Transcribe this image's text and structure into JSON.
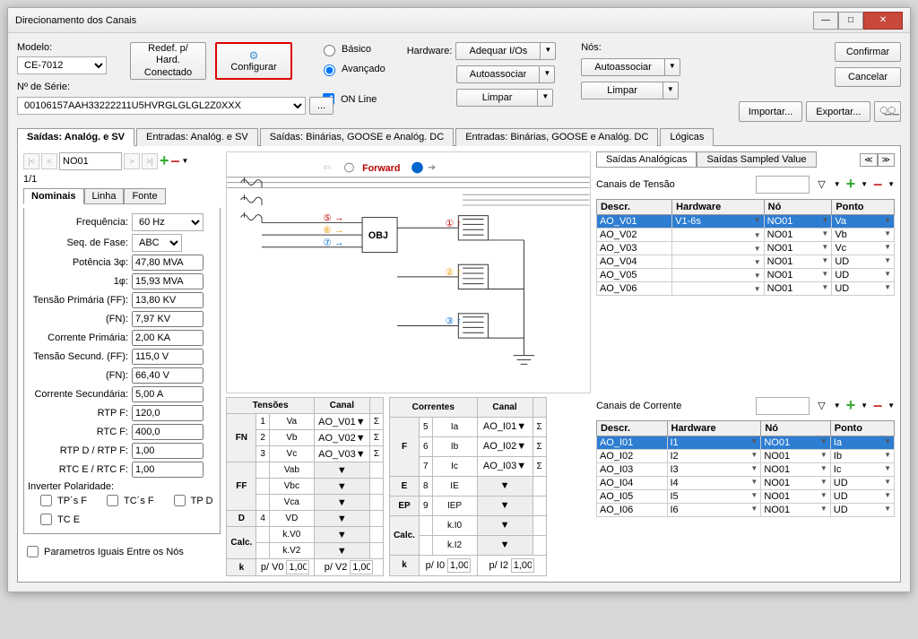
{
  "window": {
    "title": "Direcionamento dos Canais"
  },
  "top": {
    "model_lbl": "Modelo:",
    "model_val": "CE-7012",
    "serial_lbl": "Nº de Série:",
    "serial_val": "00106157AAH33222211U5HVRGLGLGL2Z0XXX",
    "redef": "Redef. p/ Hard.\nConectado",
    "configurar": "Configurar",
    "basico": "Básico",
    "avancado": "Avançado",
    "online": "ON Line",
    "hardware_lbl": "Hardware:",
    "adequar": "Adequar I/Os",
    "autoassociar": "Autoassociar",
    "limpar": "Limpar",
    "nos_lbl": "Nós:",
    "confirmar": "Confirmar",
    "cancelar": "Cancelar",
    "importar": "Importar...",
    "exportar": "Exportar..."
  },
  "tabs": {
    "t1": "Saídas: Analóg. e SV",
    "t2": "Entradas: Analóg. e SV",
    "t3": "Saídas: Binárias, GOOSE e Analóg. DC",
    "t4": "Entradas: Binárias, GOOSE e Analóg. DC",
    "t5": "Lógicas"
  },
  "left": {
    "node": "NO01",
    "count": "1/1",
    "sub1": "Nominais",
    "sub2": "Linha",
    "sub3": "Fonte",
    "freq_lbl": "Frequência:",
    "freq_val": "60 Hz",
    "seq_lbl": "Seq. de Fase:",
    "seq_val": "ABC",
    "pot3_lbl": "Potência 3φ:",
    "pot3_val": "47,80 MVA",
    "pot1_lbl": "1φ:",
    "pot1_val": "15,93 MVA",
    "tpff_lbl": "Tensão Primária (FF):",
    "tpff_val": "13,80 KV",
    "tpfn_lbl": "(FN):",
    "tpfn_val": "7,97 KV",
    "corrp_lbl": "Corrente Primária:",
    "corrp_val": "2,00 KA",
    "tsff_lbl": "Tensão Secund. (FF):",
    "tsff_val": "115,0 V",
    "tsfn_lbl": "(FN):",
    "tsfn_val": "66,40 V",
    "corrs_lbl": "Corrente Secundária:",
    "corrs_val": "5,00 A",
    "rtpf_lbl": "RTP F:",
    "rtpf_val": "120,0",
    "rtcf_lbl": "RTC F:",
    "rtcf_val": "400,0",
    "rtpd_lbl": "RTP D / RTP F:",
    "rtpd_val": "1,00",
    "rtce_lbl": "RTC E / RTC F:",
    "rtce_val": "1,00",
    "inv_lbl": "Inverter Polaridade:",
    "tpsf": "TP´s F",
    "tcsf": "TC´s F",
    "tpd": "TP D",
    "tce": "TC E",
    "param": "Parametros Iguais Entre os Nós"
  },
  "diagram": {
    "forward": "Forward",
    "obj": "OBJ"
  },
  "tensoes": {
    "hdr": "Tensões",
    "canal": "Canal",
    "fn": "FN",
    "ff": "FF",
    "d": "D",
    "calc": "Calc.",
    "k": "k",
    "rows": {
      "r1n": "1",
      "r1v": "Va",
      "r1c": "AO_V01",
      "r2n": "2",
      "r2v": "Vb",
      "r2c": "AO_V02",
      "r3n": "3",
      "r3v": "Vc",
      "r3c": "AO_V03",
      "r4v": "Vab",
      "r5v": "Vbc",
      "r6v": "Vca",
      "r7n": "4",
      "r7v": "VD",
      "r8v": "k.V0",
      "r9v": "k.V2",
      "pv0": "p/ V0",
      "pv0v": "1,00",
      "pv2": "p/ V2",
      "pv2v": "1,00"
    }
  },
  "correntes": {
    "hdr": "Correntes",
    "canal": "Canal",
    "f": "F",
    "e": "E",
    "ep": "EP",
    "calc": "Calc.",
    "k": "k",
    "rows": {
      "r1n": "5",
      "r1v": "Ia",
      "r1c": "AO_I01",
      "r2n": "6",
      "r2v": "Ib",
      "r2c": "AO_I02",
      "r3n": "7",
      "r3v": "Ic",
      "r3c": "AO_I03",
      "r4n": "8",
      "r4v": "IE",
      "r5n": "9",
      "r5v": "IEP",
      "r6v": "k.I0",
      "r7v": "k.I2",
      "pi0": "p/ I0",
      "pi0v": "1,00",
      "pi2": "p/ I2",
      "pi2v": "1,00"
    }
  },
  "right": {
    "tab1": "Saídas Analógicas",
    "tab2": "Saídas Sampled Value",
    "tensao_hdr": "Canais de Tensão",
    "corrente_hdr": "Canais de Corrente",
    "col_descr": "Descr.",
    "col_hw": "Hardware",
    "col_no": "Nó",
    "col_ponto": "Ponto"
  },
  "vrows": [
    {
      "d": "AO_V01",
      "hw": "V1-6s",
      "no": "NO01",
      "p": "Va"
    },
    {
      "d": "AO_V02",
      "hw": "",
      "no": "NO01",
      "p": "Vb"
    },
    {
      "d": "AO_V03",
      "hw": "",
      "no": "NO01",
      "p": "Vc"
    },
    {
      "d": "AO_V04",
      "hw": "",
      "no": "NO01",
      "p": "UD"
    },
    {
      "d": "AO_V05",
      "hw": "",
      "no": "NO01",
      "p": "UD"
    },
    {
      "d": "AO_V06",
      "hw": "",
      "no": "NO01",
      "p": "UD"
    }
  ],
  "irows": [
    {
      "d": "AO_I01",
      "hw": "I1",
      "no": "NO01",
      "p": "Ia"
    },
    {
      "d": "AO_I02",
      "hw": "I2",
      "no": "NO01",
      "p": "Ib"
    },
    {
      "d": "AO_I03",
      "hw": "I3",
      "no": "NO01",
      "p": "Ic"
    },
    {
      "d": "AO_I04",
      "hw": "I4",
      "no": "NO01",
      "p": "UD"
    },
    {
      "d": "AO_I05",
      "hw": "I5",
      "no": "NO01",
      "p": "UD"
    },
    {
      "d": "AO_I06",
      "hw": "I6",
      "no": "NO01",
      "p": "UD"
    }
  ]
}
